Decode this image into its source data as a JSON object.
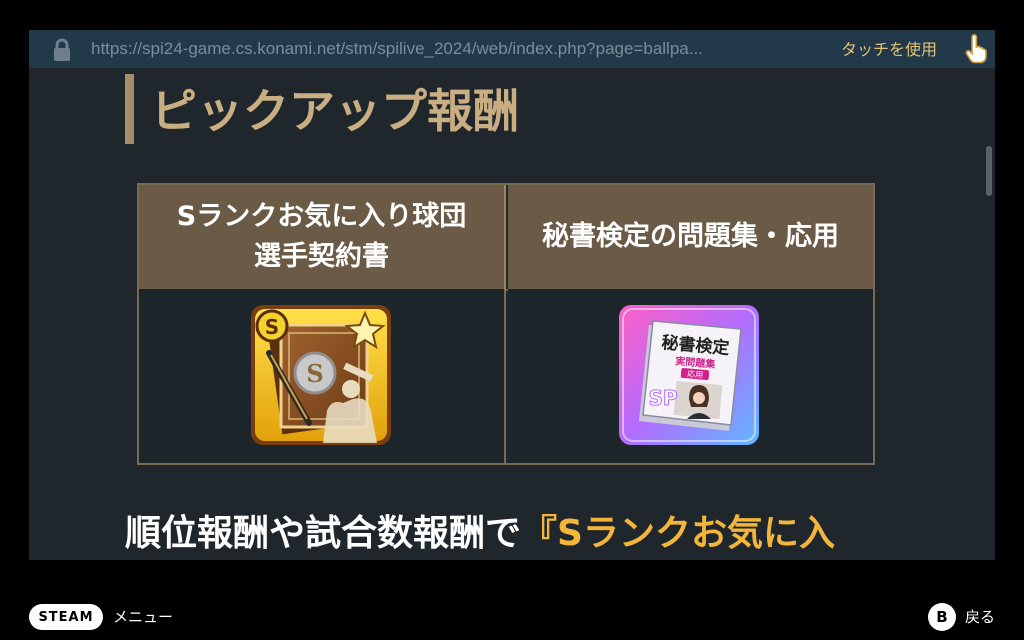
{
  "browser": {
    "url": "https://spi24-game.cs.konami.net/stm/spilive_2024/web/index.php?page=ballpa...",
    "touch_label": "タッチを使用",
    "lock_icon": "lock-icon",
    "touch_icon": "pointing-hand-icon"
  },
  "page": {
    "heading": "ピックアップ報酬",
    "table": {
      "headers": [
        {
          "line1": "Sランクお気に入り球団",
          "line2": "選手契約書"
        },
        {
          "line1": "秘書検定の問題集・応用",
          "line2": ""
        }
      ],
      "items": [
        {
          "icon": "s-rank-contract-icon",
          "badge": "S"
        },
        {
          "icon": "secretary-workbook-icon",
          "book_title": "秘書検定",
          "book_sub": "実問題集",
          "book_tag": "応用",
          "badge": "SP"
        }
      ]
    },
    "description": {
      "text": "順位報酬や試合数報酬で",
      "highlight": "『Sランクお気に入"
    }
  },
  "steam_bar": {
    "steam_label": "STEAM",
    "menu_label": "メニュー",
    "b_label": "B",
    "back_label": "戻る"
  },
  "colors": {
    "accent_gold": "#c9ad83",
    "highlight_orange": "#f3b53a",
    "table_header": "#6b5a46",
    "url_bar": "#22394a"
  }
}
